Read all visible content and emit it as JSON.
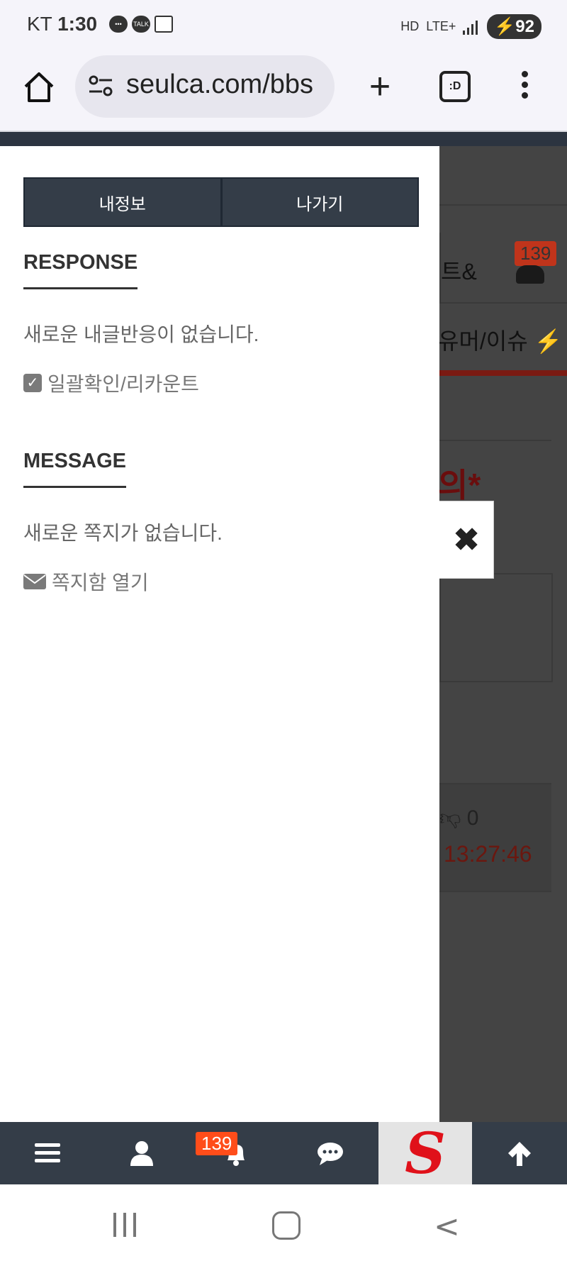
{
  "status_bar": {
    "carrier": "KT",
    "time": "1:30",
    "network": "LTE+",
    "hd": "HD",
    "battery": "92"
  },
  "browser": {
    "url": "seulca.com/bbs",
    "tabs_label": ":D"
  },
  "drawer": {
    "buttons": {
      "my_info": "내정보",
      "logout": "나가기"
    },
    "response": {
      "title": "RESPONSE",
      "empty_text": "새로운 내글반응이 없습니다.",
      "action": "일괄확인/리카운트"
    },
    "message": {
      "title": "MESSAGE",
      "empty_text": "새로운 쪽지가 없습니다.",
      "action": "쪽지함 열기"
    },
    "close_symbol": "✖"
  },
  "background_page": {
    "tab_text": "트&",
    "badge": "139",
    "humor_tab": "유머/이슈 ⚡",
    "title_fragment": "의*",
    "dislike_count": "0",
    "timestamp": "13:27:46"
  },
  "bottom_nav": {
    "notification_count": "139",
    "logo_letter": "S"
  }
}
